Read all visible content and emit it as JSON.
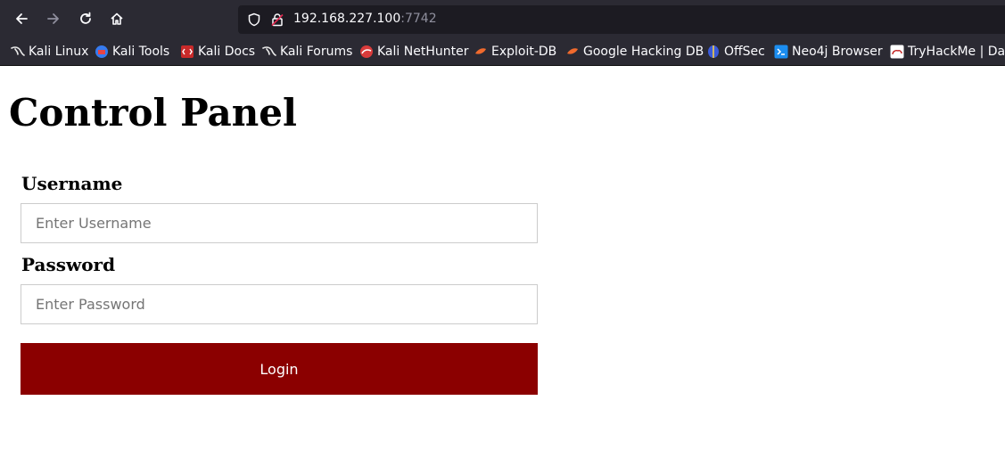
{
  "browser": {
    "url_host": "192.168.227.100",
    "url_port": ":7742",
    "bookmarks": [
      {
        "label": "Kali Linux",
        "icon": "kali-dragon-icon"
      },
      {
        "label": "Kali Tools",
        "icon": "kali-tools-icon"
      },
      {
        "label": "Kali Docs",
        "icon": "kali-docs-icon"
      },
      {
        "label": "Kali Forums",
        "icon": "kali-dragon-icon"
      },
      {
        "label": "Kali NetHunter",
        "icon": "nethunter-icon"
      },
      {
        "label": "Exploit-DB",
        "icon": "exploit-db-icon"
      },
      {
        "label": "Google Hacking DB",
        "icon": "ghdb-icon"
      },
      {
        "label": "OffSec",
        "icon": "offsec-icon"
      },
      {
        "label": "Neo4j Browser",
        "icon": "neo4j-icon"
      },
      {
        "label": "TryHackMe | Das",
        "icon": "tryhackme-icon"
      }
    ]
  },
  "page": {
    "title": "Control Panel",
    "username_label": "Username",
    "username_placeholder": "Enter Username",
    "password_label": "Password",
    "password_placeholder": "Enter Password",
    "login_label": "Login"
  },
  "colors": {
    "login_button": "#8b0000",
    "chrome_bg": "#2b2a33",
    "urlbar_bg": "#1c1b22"
  }
}
